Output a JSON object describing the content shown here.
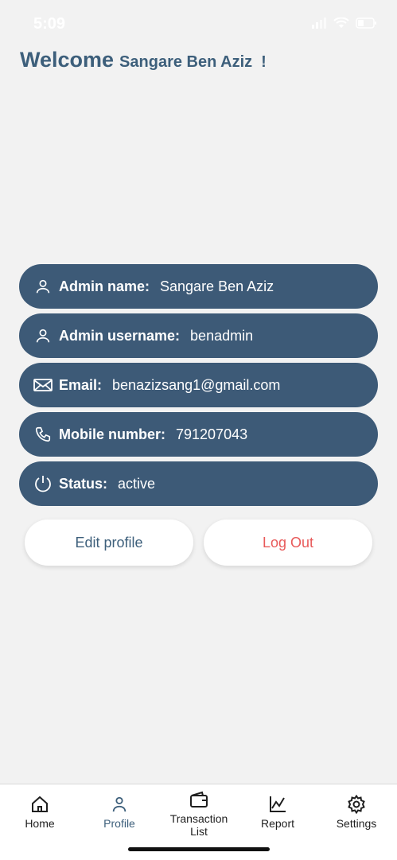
{
  "status_bar": {
    "time": "5:09"
  },
  "header": {
    "welcome_word": "Welcome",
    "user_name": "Sangare Ben Aziz",
    "exclaim": "!"
  },
  "profile": {
    "admin_name": {
      "label": "Admin name:",
      "value": "Sangare Ben Aziz",
      "icon": "person-icon"
    },
    "admin_username": {
      "label": "Admin username:",
      "value": "benadmin",
      "icon": "person-icon"
    },
    "email": {
      "label": "Email:",
      "value": "benazizsang1@gmail.com",
      "icon": "mail-icon"
    },
    "mobile": {
      "label": "Mobile number:",
      "value": "791207043",
      "icon": "phone-icon"
    },
    "status": {
      "label": "Status:",
      "value": "active",
      "icon": "power-icon"
    }
  },
  "actions": {
    "edit_profile": "Edit profile",
    "log_out": "Log Out"
  },
  "tab_bar": {
    "home": "Home",
    "profile": "Profile",
    "transaction_list": "Transaction List",
    "report": "Report",
    "settings": "Settings",
    "active_tab": "profile"
  },
  "colors": {
    "card_bg": "#3d5a77",
    "accent": "#3d5f7b",
    "logout": "#e85a5a",
    "background": "#f2f2f2"
  }
}
